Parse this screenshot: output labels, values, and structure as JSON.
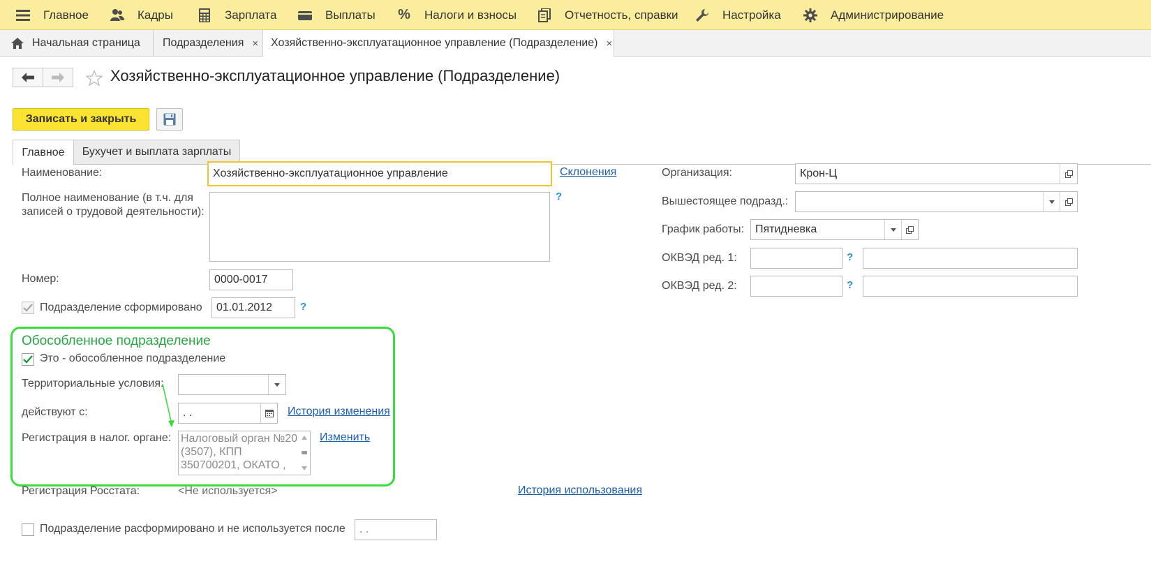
{
  "menu": [
    {
      "icon": "hamburger-icon",
      "label": "Главное"
    },
    {
      "icon": "people-icon",
      "label": "Кадры"
    },
    {
      "icon": "calculator-icon",
      "label": "Зарплата"
    },
    {
      "icon": "wallet-icon",
      "label": "Выплаты"
    },
    {
      "icon": "percent-icon",
      "label": "Налоги и взносы"
    },
    {
      "icon": "documents-icon",
      "label": "Отчетность, справки"
    },
    {
      "icon": "wrench-icon",
      "label": "Настройка"
    },
    {
      "icon": "gear-icon",
      "label": "Администрирование"
    }
  ],
  "open_tabs": [
    {
      "label": "Начальная страница",
      "icon": "home-icon"
    },
    {
      "label": "Подразделения",
      "close": "×"
    },
    {
      "label": "Хозяйственно-эксплуатационное управление (Подразделение)",
      "close": "×",
      "active": true
    }
  ],
  "title": "Хозяйственно-эксплуатационное управление (Подразделение)",
  "commands": {
    "save_close": "Записать и закрыть"
  },
  "form_tabs": [
    "Главное",
    "Бухучет и выплата зарплаты"
  ],
  "fields": {
    "name_label": "Наименование:",
    "name_value": "Хозяйственно-эксплуатационное управление",
    "declensions_link": "Склонения",
    "full_name_label_1": "Полное наименование (в т.ч. для",
    "full_name_label_2": "записей о трудовой деятельности):",
    "full_name_value": "",
    "help": "?",
    "number_label": "Номер:",
    "number_value": "0000-0017",
    "formed_label": "Подразделение сформировано",
    "formed_date": "01.01.2012",
    "org_label": "Организация:",
    "org_value": "Крон-Ц",
    "parent_label": "Вышестоящее подразд.:",
    "parent_value": "",
    "schedule_label": "График работы:",
    "schedule_value": "Пятидневка",
    "okved1_label": "ОКВЭД ред. 1:",
    "okved2_label": "ОКВЭД ред. 2:"
  },
  "separate_group": {
    "title": "Обособленное подразделение",
    "is_separate_label": "Это - обособленное подразделение",
    "territorial_label": "Территориальные условия:",
    "territorial_value": "",
    "effective_label": "действуют с:",
    "effective_value": " .  .",
    "history_link": "История изменения",
    "tax_reg_label": "Регистрация в налог. органе:",
    "tax_reg_value": "Налоговый орган №20 (3507), КПП 350700201, ОКАТО ,",
    "change_link": "Изменить"
  },
  "rosstat": {
    "label": "Регистрация Росстата:",
    "value": "<Не используется>",
    "history_link": "История использования"
  },
  "disbanded": {
    "label": "Подразделение расформировано и не используется после",
    "date_value": " .  ."
  },
  "colors": {
    "accent": "#fbe233",
    "menu_bg": "#fbed9e",
    "group_border": "#3edb3e",
    "group_title": "#2aa545",
    "link": "#1c5fad"
  }
}
